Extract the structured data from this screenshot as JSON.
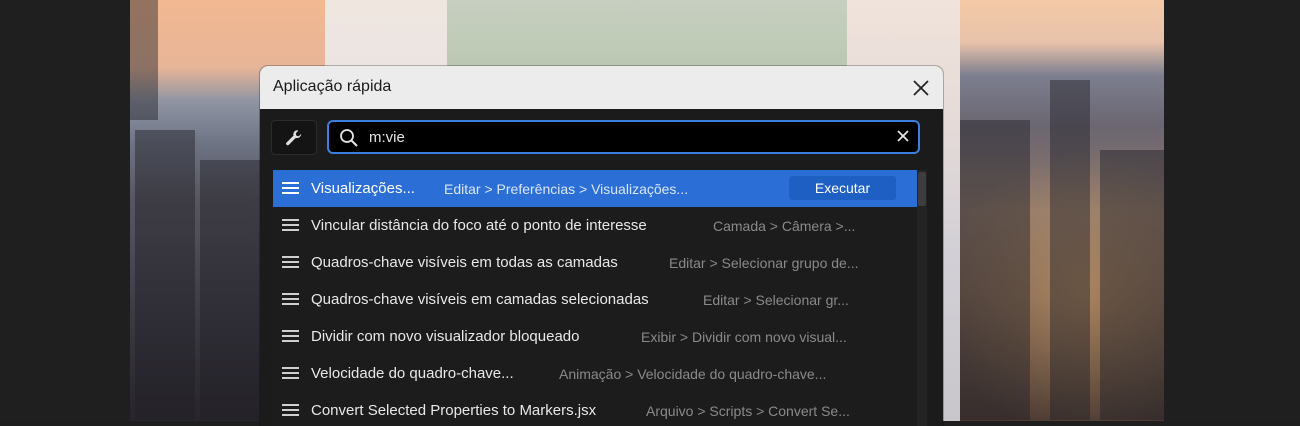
{
  "dialog": {
    "title": "Aplicação rápida"
  },
  "search": {
    "value": "m:vie"
  },
  "results": [
    {
      "label": "Visualizações...",
      "path": "Editar > Preferências > Visualizações...",
      "selected": true
    },
    {
      "label": "Vincular distância do foco até o ponto de interesse",
      "path": "Camada > Câmera >..."
    },
    {
      "label": "Quadros-chave visíveis em todas as camadas",
      "path": "Editar > Selecionar grupo de..."
    },
    {
      "label": "Quadros-chave visíveis em camadas selecionadas",
      "path": "Editar > Selecionar gr..."
    },
    {
      "label": "Dividir com novo visualizador bloqueado",
      "path": "Exibir > Dividir com novo visual..."
    },
    {
      "label": "Velocidade do quadro-chave...",
      "path": "Animação > Velocidade do quadro-chave..."
    },
    {
      "label": "Convert Selected Properties to Markers.jsx",
      "path": "Arquivo > Scripts > Convert Se..."
    }
  ],
  "execute_label": "Executar",
  "colors": {
    "accent": "#2b6fd6",
    "search_border": "#3b7fe0",
    "execute_button": "#1e5fc4"
  },
  "icons": {
    "tool": "wrench-icon",
    "search": "search-icon",
    "clear": "clear-icon",
    "close": "close-icon",
    "row": "hamburger-icon"
  }
}
